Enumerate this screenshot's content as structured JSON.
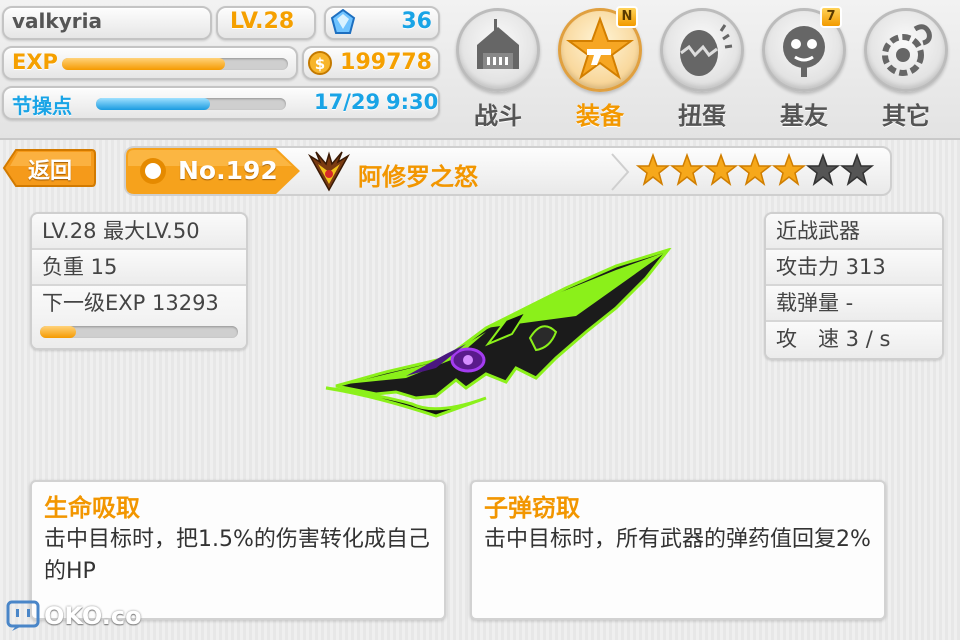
{
  "player": {
    "name": "valkyria",
    "level": "LV.28",
    "exp_label": "EXP",
    "exp_progress": 0.72,
    "gems": "36",
    "coins": "199778",
    "stamina_label": "节操点",
    "stamina_progress": 0.6,
    "stamina": "17/29",
    "timer": "9:30"
  },
  "nav": [
    {
      "label": "战斗",
      "icon": "castle-icon",
      "active": false,
      "badge": ""
    },
    {
      "label": "装备",
      "icon": "gun-star-icon",
      "active": true,
      "badge": "N"
    },
    {
      "label": "扭蛋",
      "icon": "egg-icon",
      "active": false,
      "badge": ""
    },
    {
      "label": "基友",
      "icon": "friend-face-icon",
      "active": false,
      "badge": "7"
    },
    {
      "label": "其它",
      "icon": "gear-question-icon",
      "active": false,
      "badge": ""
    }
  ],
  "header": {
    "back_label": "返回",
    "number": "No.192",
    "weapon_name": "阿修罗之怒",
    "stars_filled": 5,
    "stars_total": 7
  },
  "left_card": {
    "level": "LV.28 最大LV.50",
    "weight": "负重 15",
    "next_exp": "下一级EXP 13293",
    "progress": 0.18
  },
  "right_card": {
    "type": "近战武器",
    "attack": "攻击力 313",
    "ammo": "载弹量 -",
    "speed": "攻　速 3 / s"
  },
  "skills": [
    {
      "title": "生命吸取",
      "desc": "击中目标时，把1.5%的伤害转化成自己的HP"
    },
    {
      "title": "子弹窃取",
      "desc": "击中目标时，所有武器的弹药值回复2%"
    }
  ],
  "watermark": "OKO.co",
  "colors": {
    "accent": "#f5a000",
    "blue": "#19a4e6",
    "weapon_green": "#8bf01a",
    "weapon_purple": "#5a1a8c"
  }
}
